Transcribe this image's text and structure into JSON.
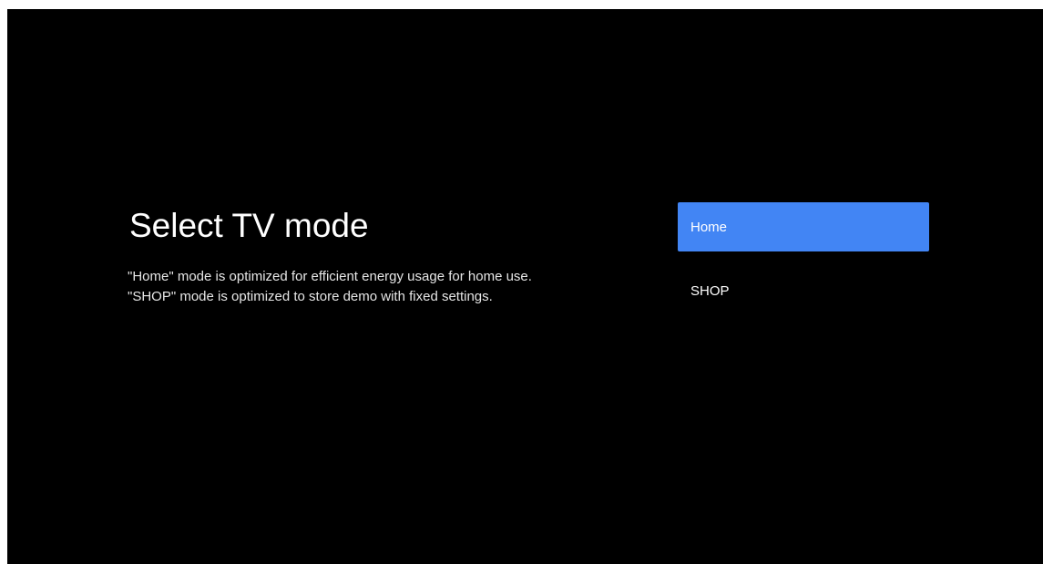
{
  "screen": {
    "title": "Select TV mode",
    "description": [
      "\"Home\" mode is optimized for efficient energy usage for home use.",
      "\"SHOP\" mode is optimized to store demo with fixed settings."
    ]
  },
  "options": [
    {
      "label": "Home",
      "selected": true
    },
    {
      "label": "SHOP",
      "selected": false
    }
  ],
  "colors": {
    "background": "#000000",
    "accent": "#4285f4",
    "text": "#ffffff"
  }
}
